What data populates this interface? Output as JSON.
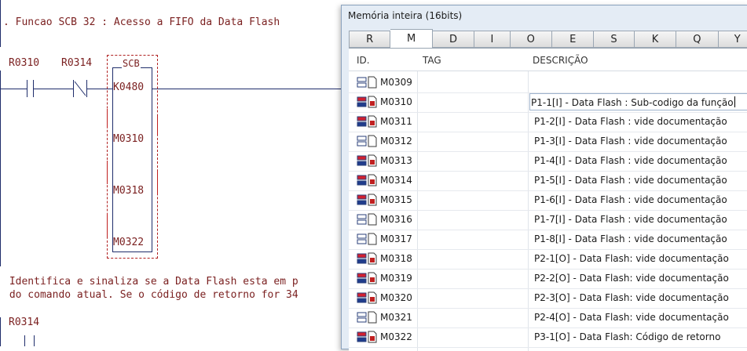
{
  "ladder": {
    "comment_line1": ". Funcao SCB 32 : Acesso a FIFO da Data Flash",
    "contact1": "R0310",
    "contact2": "R0314",
    "block_title": "SCB",
    "block_params": [
      "K0480",
      "M0310",
      "M0318",
      "M0322"
    ],
    "comment_line2": " Identifica e sinaliza se a Data Flash esta em p",
    "comment_line3": " do comando atual. Se o código de retorno for 34",
    "contact3": "R0314"
  },
  "window": {
    "title": "Memória inteira (16bits)",
    "tabs": [
      "R",
      "M",
      "D",
      "I",
      "O",
      "E",
      "S",
      "K",
      "Q",
      "Y"
    ],
    "active_tab": "M",
    "columns": {
      "id": "ID.",
      "tag": "TAG",
      "desc": "DESCRIÇÃO"
    },
    "rows": [
      {
        "id": "M0309",
        "tag": "",
        "desc": "",
        "icon": "memory-empty-icon"
      },
      {
        "id": "M0310",
        "tag": "",
        "desc": "P1-1[I] - Data Flash : Sub-codigo da função",
        "icon": "memory-used-icon"
      },
      {
        "id": "M0311",
        "tag": "",
        "desc": "P1-2[I] - Data Flash : vide documentação",
        "icon": "memory-used-icon"
      },
      {
        "id": "M0312",
        "tag": "",
        "desc": "P1-3[I] - Data Flash : vide documentação",
        "icon": "memory-empty-icon"
      },
      {
        "id": "M0313",
        "tag": "",
        "desc": "P1-4[I] - Data Flash : vide documentação",
        "icon": "memory-used-icon"
      },
      {
        "id": "M0314",
        "tag": "",
        "desc": "P1-5[I] - Data Flash : vide documentação",
        "icon": "memory-used-icon"
      },
      {
        "id": "M0315",
        "tag": "",
        "desc": "P1-6[I] - Data Flash : vide documentação",
        "icon": "memory-used-icon"
      },
      {
        "id": "M0316",
        "tag": "",
        "desc": "P1-7[I] - Data Flash : vide documentação",
        "icon": "memory-empty-icon"
      },
      {
        "id": "M0317",
        "tag": "",
        "desc": "P1-8[I] - Data Flash : vide documentação",
        "icon": "memory-empty-icon"
      },
      {
        "id": "M0318",
        "tag": "",
        "desc": "P2-1[O] - Data Flash: vide documentação",
        "icon": "memory-used-icon"
      },
      {
        "id": "M0319",
        "tag": "",
        "desc": "P2-2[O] - Data Flash: vide documentação",
        "icon": "memory-used-icon"
      },
      {
        "id": "M0320",
        "tag": "",
        "desc": "P2-3[O] - Data Flash: vide documentação",
        "icon": "memory-used-icon"
      },
      {
        "id": "M0321",
        "tag": "",
        "desc": "P2-4[O] - Data Flash: vide documentação",
        "icon": "memory-empty-icon"
      },
      {
        "id": "M0322",
        "tag": "",
        "desc": "P3-1[O] - Data Flash: Código de retorno",
        "icon": "memory-used-icon"
      }
    ]
  },
  "colors": {
    "ladder_text": "#7a1f1f",
    "wire": "#1f2d6b",
    "window_bg": "#e4ecf5"
  }
}
